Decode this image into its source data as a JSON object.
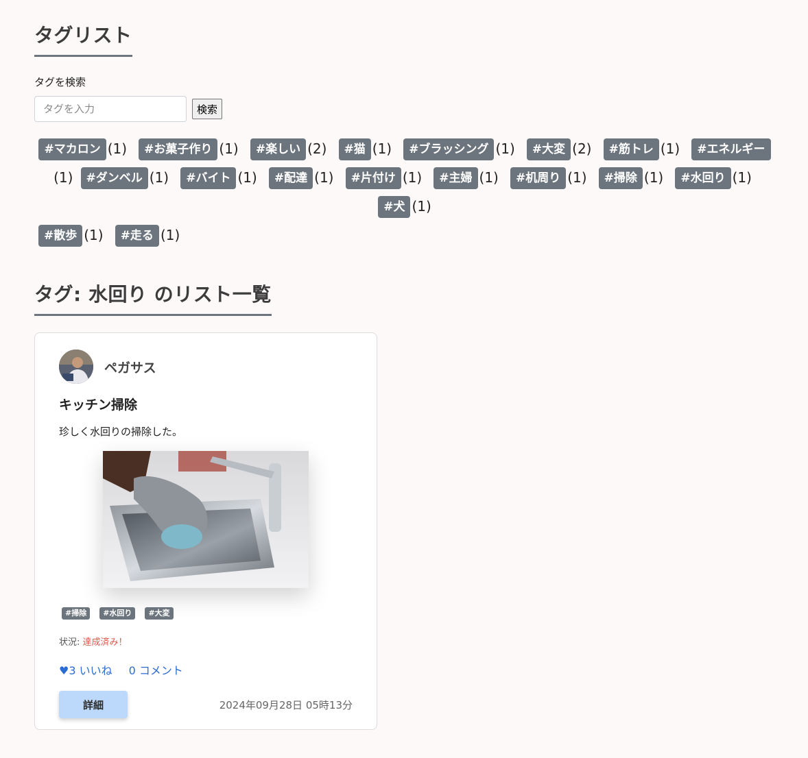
{
  "tag_list": {
    "title": "タグリスト",
    "search_label": "タグを検索",
    "search_placeholder": "タグを入力",
    "search_button": "検索",
    "tags": [
      {
        "label": "#マカロン",
        "count": "(1)"
      },
      {
        "label": "#お菓子作り",
        "count": "(1)"
      },
      {
        "label": "#楽しい",
        "count": "(2)"
      },
      {
        "label": "#猫",
        "count": "(1)"
      },
      {
        "label": "#ブラッシング",
        "count": "(1)"
      },
      {
        "label": "#大変",
        "count": "(2)"
      },
      {
        "label": "#筋トレ",
        "count": "(1)"
      },
      {
        "label": "#エネルギー",
        "count": "(1)"
      },
      {
        "label": "#ダンベル",
        "count": "(1)"
      },
      {
        "label": "#バイト",
        "count": "(1)"
      },
      {
        "label": "#配達",
        "count": "(1)"
      },
      {
        "label": "#片付け",
        "count": "(1)"
      },
      {
        "label": "#主婦",
        "count": "(1)"
      },
      {
        "label": "#机周り",
        "count": "(1)"
      },
      {
        "label": "#掃除",
        "count": "(1)"
      },
      {
        "label": "#水回り",
        "count": "(1)"
      },
      {
        "label": "#犬",
        "count": "(1)"
      },
      {
        "label": "#散歩",
        "count": "(1)"
      },
      {
        "label": "#走る",
        "count": "(1)"
      }
    ]
  },
  "list_section": {
    "title": "タグ: 水回り のリスト一覧"
  },
  "card": {
    "user_name": "ペガサス",
    "title": "キッチン掃除",
    "body": "珍しく水回りの掃除した。",
    "tags": [
      "#掃除",
      "#水回り",
      "#大変"
    ],
    "status_label": "状況:",
    "status_value": "達成済み！",
    "likes": "♥3 いいね",
    "comments": "0 コメント",
    "detail_button": "詳細",
    "timestamp": "2024年09月28日 05時13分"
  },
  "colors": {
    "tag_bg": "#6c757d",
    "status_done": "#e2574c",
    "link_blue": "#2b6cd4",
    "detail_button_bg": "#bcd8fb"
  }
}
